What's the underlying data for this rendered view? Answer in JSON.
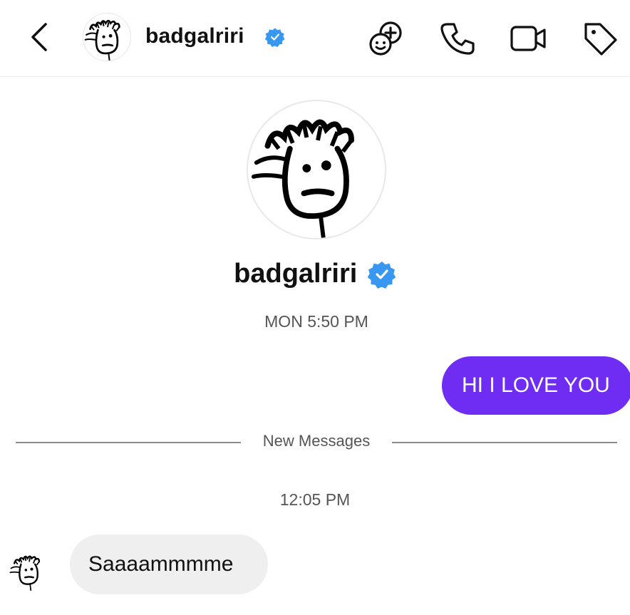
{
  "header": {
    "username": "badgalriri",
    "verified": true
  },
  "profile": {
    "username": "badgalriri",
    "verified": true
  },
  "conversation": {
    "first_timestamp": "MON 5:50 PM",
    "outgoing_message": "HI I LOVE YOU",
    "divider_label": "New Messages",
    "second_timestamp": "12:05 PM",
    "incoming_message": "Saaaammmme"
  },
  "colors": {
    "outgoing_bubble": "#6f2cf2",
    "incoming_bubble": "#efefef",
    "verified_badge": "#3897f0"
  },
  "icons": [
    "back-chevron-icon",
    "effects-icon",
    "phone-icon",
    "video-camera-icon",
    "tag-icon",
    "verified-badge-icon"
  ]
}
